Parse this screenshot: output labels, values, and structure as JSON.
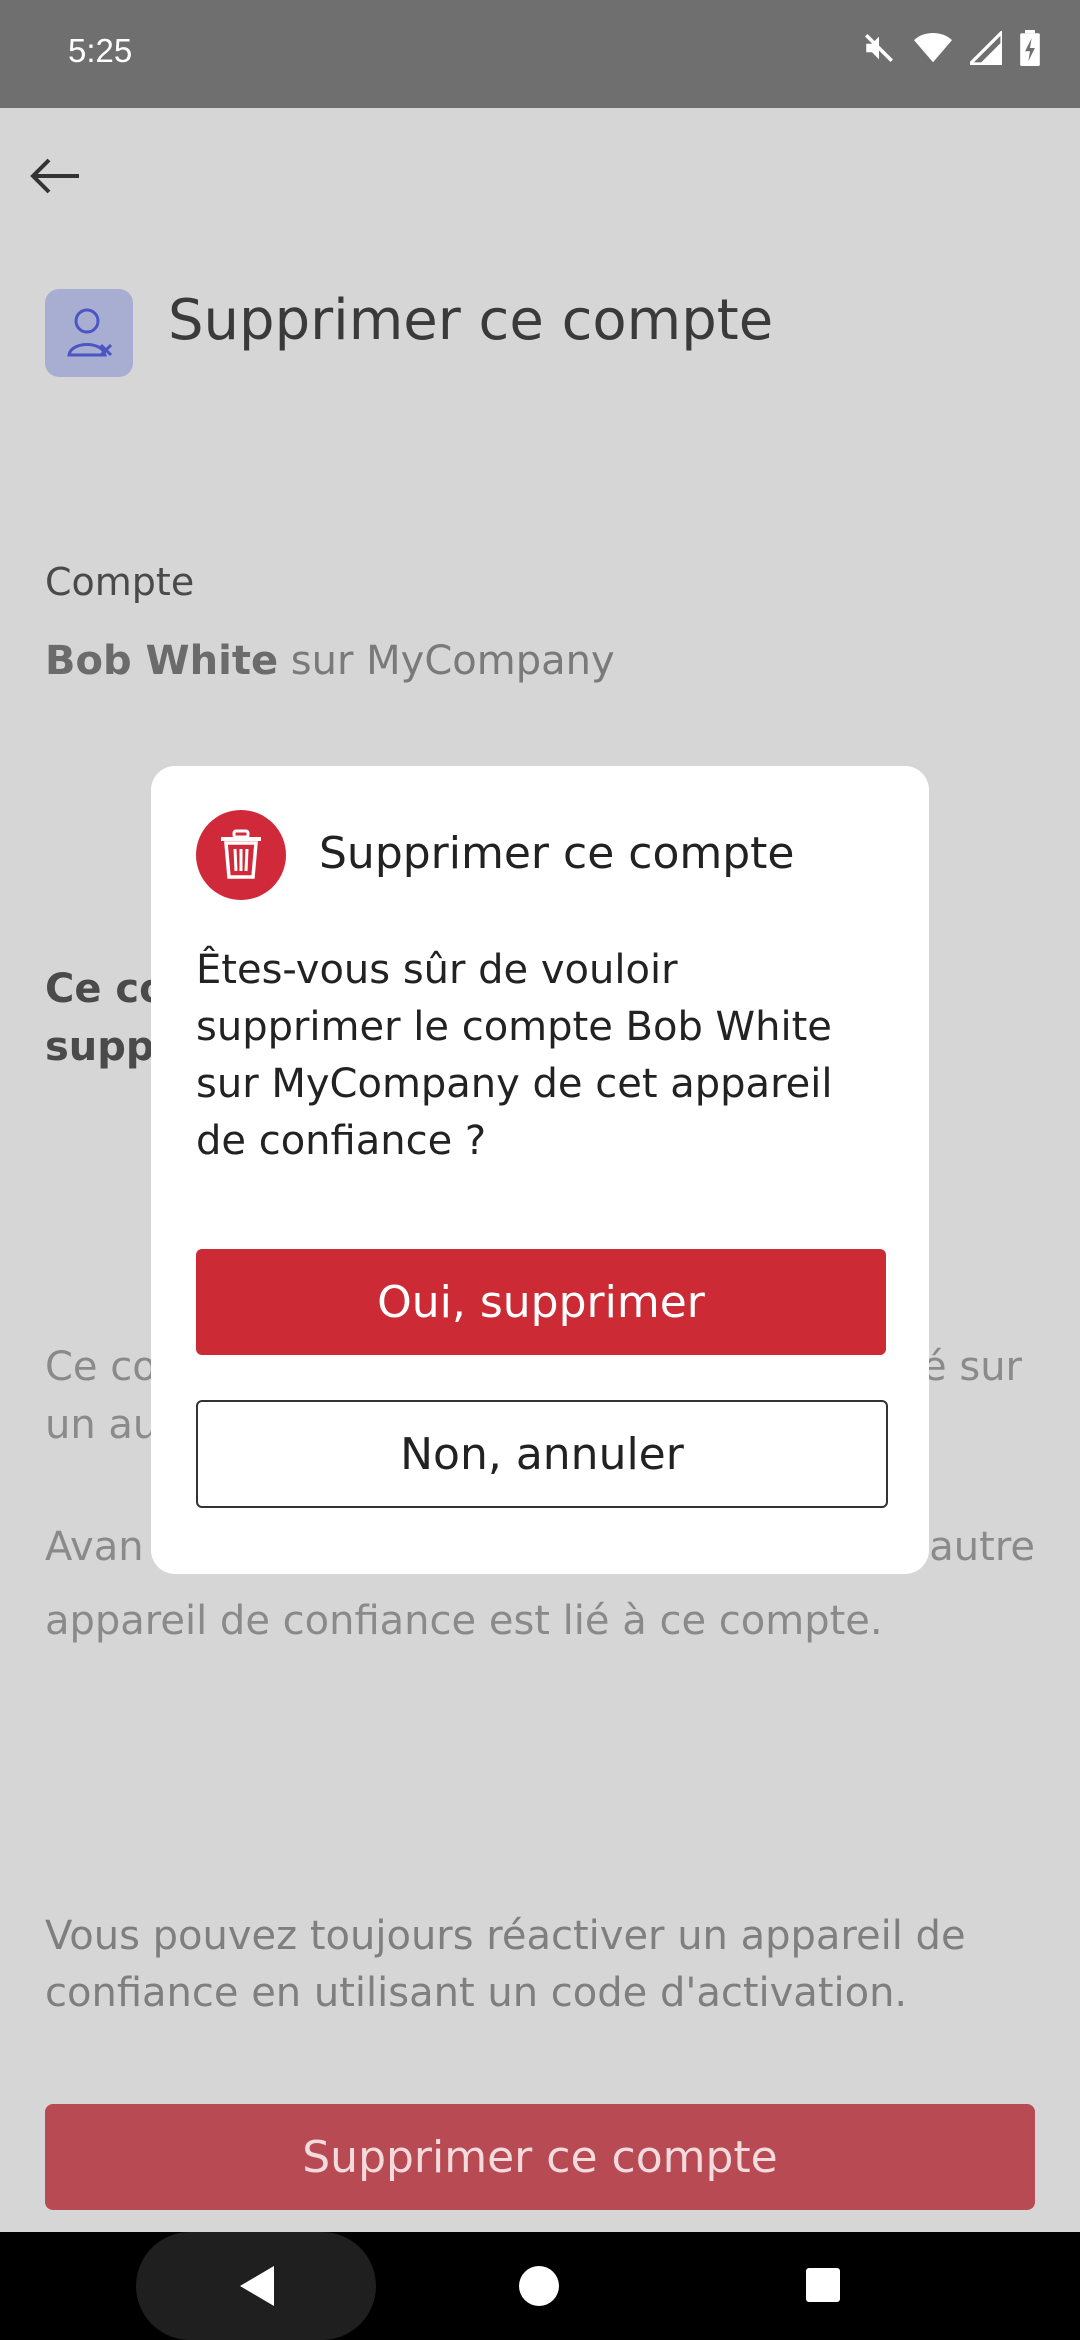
{
  "status_bar": {
    "time": "5:25",
    "icons": [
      "mute-icon",
      "wifi-icon",
      "signal-icon",
      "battery-charging-icon"
    ]
  },
  "page": {
    "title": "Supprimer ce compte",
    "account_label": "Compte",
    "account_name": "Bob White",
    "account_suffix": " sur MyCompany",
    "partial_bold_line1": "Ce co",
    "partial_bold_line2": "supp",
    "partial_grey_line1": "Ce co",
    "partial_grey_line2": "un au",
    "partial_grey_right": "é sur",
    "partial_grey_line3": "Avan",
    "partial_grey_right2": "autre",
    "full_grey_line": "appareil de confiance est lié à ce compte.",
    "info_text": "Vous pouvez toujours réactiver un appareil de confiance en utilisant un code d'activation.",
    "primary_button_label": "Supprimer ce compte"
  },
  "dialog": {
    "title": "Supprimer ce compte",
    "message": "Êtes-vous sûr de vouloir supprimer le compte Bob White sur MyCompany de cet appareil de confiance ?",
    "confirm_label": "Oui, supprimer",
    "cancel_label": "Non, annuler"
  },
  "colors": {
    "accent_red": "#cc2a35",
    "scrim": "#d6d6d6"
  }
}
